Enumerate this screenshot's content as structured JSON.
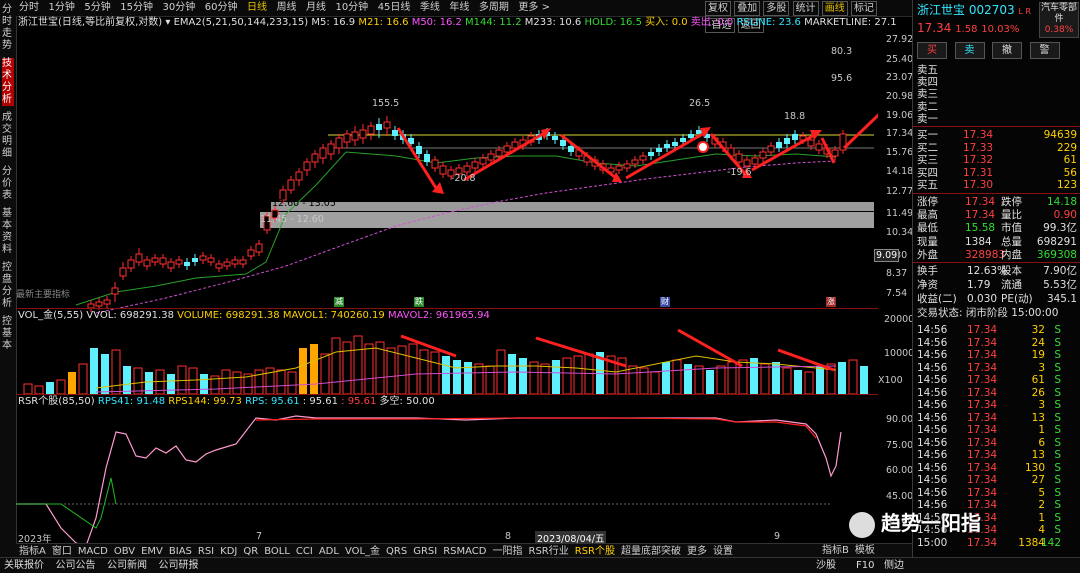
{
  "left_sidebar": [
    "分时走势",
    "技术分析",
    "成交明细",
    "分价表",
    "基本资料",
    "控盘分析",
    "控基本"
  ],
  "periods": [
    "分时",
    "1分钟",
    "5分钟",
    "15分钟",
    "30分钟",
    "60分钟",
    "日线",
    "周线",
    "月线",
    "10分钟",
    "45日线",
    "季线",
    "年线",
    "多周期",
    "更多 >"
  ],
  "active_period": "日线",
  "right_tools": [
    "复权",
    "叠加",
    "多股",
    "统计",
    "画线",
    "标记",
    "-自选",
    "返回"
  ],
  "ma_line": {
    "title": "浙江世宝(日线,等比前复权,对数)",
    "ema": "EMA2(5,21,50,144,233,15)",
    "m5": "M5: 16.9",
    "m21": "M21: 16.6",
    "m50": "M50: 16.2",
    "m144": "M144: 11.2",
    "m233": "M233: 10.6",
    "hold": "HOLD: 16.5",
    "buy": "买入: 0.0",
    "sell": "卖出: 0.0",
    "rsline": "RSLINE: 23.6",
    "marketline": "MARKETLINE: 27.1"
  },
  "price_axis": [
    "27.92",
    "25.40",
    "23.07",
    "20.98",
    "19.06",
    "17.34",
    "15.76",
    "14.18",
    "12.77",
    "11.49",
    "10.34",
    "9.30",
    "8.37",
    "7.54"
  ],
  "price_marker": "9.09",
  "chart_labels": {
    "l80_3": "80.3",
    "l95_6": "95.6",
    "l155_5": "155.5",
    "l26_5": "26.5",
    "l18_8": "18.8",
    "lm20_8": "-20.8",
    "lm19_6": "-19.6",
    "band_upper": "12.60 - 13.05",
    "band_lower": "11.45 - 12.60",
    "bottom_left": "最新主要指标"
  },
  "event_tags": [
    "减",
    "跌",
    "财",
    "涨"
  ],
  "vol_line": {
    "title": "VOL_金(5,55)",
    "vvol": "VVOL: 698291.38",
    "volume": "VOLUME: 698291.38",
    "mavol1": "MAVOL1: 740260.19",
    "mavol2": "MAVOL2: 961965.94"
  },
  "vol_axis": [
    "20000",
    "10000",
    "X100"
  ],
  "rsr_line": {
    "title": "RSR个股(85,50)",
    "rps41": "RPS41: 91.48",
    "rps144": "RPS144: 99.73",
    "rps": "RPS: 95.61",
    "rps2": ": 95.61",
    "rps3": ": 95.61",
    "dk": "多空: 50.00"
  },
  "rsr_axis": [
    "90.00",
    "75.00",
    "60.00",
    "45.00",
    "30.00"
  ],
  "date_axis": {
    "start": "2023年",
    "m7": "7",
    "m8": "8",
    "cursor": "2023/08/04/五",
    "m9": "9"
  },
  "bottom_tabs": [
    "指标A",
    "窗口",
    "MACD",
    "OBV",
    "EMV",
    "BIAS",
    "RSI",
    "KDJ",
    "QR",
    "BOLL",
    "CCI",
    "ADL",
    "VOL_金",
    "QRS",
    "GRSI",
    "RSMACD",
    "一阳指",
    "RSR行业",
    "RSR个股",
    "超量底部突破",
    "更多",
    "设置"
  ],
  "active_tab": "RSR个股",
  "bottom_right": [
    "指标B",
    "模板"
  ],
  "status": [
    "关联报价",
    "公司公告",
    "公司新闻",
    "公司研报"
  ],
  "status_right": [
    "沙股",
    "F10",
    "侧边"
  ],
  "panel": {
    "name": "浙江世宝",
    "code": "002703",
    "lr": "L R",
    "industry": "汽车零部件",
    "industry_pct": "0.38%",
    "price": "17.34",
    "change": "1.58",
    "pct": "10.03%",
    "btn_buy": "买",
    "btn_sell": "卖",
    "btn_cancel": "撤",
    "btn_alert": "警",
    "sell_rows": [
      "卖五",
      "卖四",
      "卖三",
      "卖二",
      "卖一"
    ],
    "buy_rows": [
      {
        "label": "买一",
        "price": "17.34",
        "vol": "94639"
      },
      {
        "label": "买二",
        "price": "17.33",
        "vol": "229"
      },
      {
        "label": "买三",
        "price": "17.32",
        "vol": "61"
      },
      {
        "label": "买四",
        "price": "17.31",
        "vol": "56"
      },
      {
        "label": "买五",
        "price": "17.30",
        "vol": "123"
      }
    ],
    "stats": [
      {
        "k1": "涨停",
        "v1": "17.34",
        "c1": "red",
        "k2": "跌停",
        "v2": "14.18",
        "c2": "grn"
      },
      {
        "k1": "最高",
        "v1": "17.34",
        "c1": "red",
        "k2": "量比",
        "v2": "0.90",
        "c2": "red"
      },
      {
        "k1": "最低",
        "v1": "15.58",
        "c1": "grn",
        "k2": "市值",
        "v2": "99.3亿",
        "c2": "wht"
      },
      {
        "k1": "现量",
        "v1": "1384",
        "c1": "wht",
        "k2": "总量",
        "v2": "698291",
        "c2": "wht"
      },
      {
        "k1": "外盘",
        "v1": "328983",
        "c1": "red",
        "k2": "内盘",
        "v2": "369308",
        "c2": "grn"
      }
    ],
    "stats2": [
      {
        "k1": "换手",
        "v1": "12.63%",
        "k2": "股本",
        "v2": "7.90亿"
      },
      {
        "k1": "净资",
        "v1": "1.79",
        "k2": "流通",
        "v2": "5.53亿"
      },
      {
        "k1": "收益(二)",
        "v1": "0.030",
        "k2": "PE(动)",
        "v2": "345.1"
      }
    ],
    "trade_state": "交易状态: 闭市阶段 15:00:00",
    "ticks": [
      {
        "t": "14:56",
        "p": "17.34",
        "v": "32",
        "s": "S"
      },
      {
        "t": "14:56",
        "p": "17.34",
        "v": "24",
        "s": "S"
      },
      {
        "t": "14:56",
        "p": "17.34",
        "v": "19",
        "s": "S"
      },
      {
        "t": "14:56",
        "p": "17.34",
        "v": "3",
        "s": "S"
      },
      {
        "t": "14:56",
        "p": "17.34",
        "v": "61",
        "s": "S"
      },
      {
        "t": "14:56",
        "p": "17.34",
        "v": "26",
        "s": "S"
      },
      {
        "t": "14:56",
        "p": "17.34",
        "v": "3",
        "s": "S"
      },
      {
        "t": "14:56",
        "p": "17.34",
        "v": "13",
        "s": "S"
      },
      {
        "t": "14:56",
        "p": "17.34",
        "v": "1",
        "s": "S"
      },
      {
        "t": "14:56",
        "p": "17.34",
        "v": "6",
        "s": "S"
      },
      {
        "t": "14:56",
        "p": "17.34",
        "v": "13",
        "s": "S"
      },
      {
        "t": "14:56",
        "p": "17.34",
        "v": "130",
        "s": "S"
      },
      {
        "t": "14:56",
        "p": "17.34",
        "v": "27",
        "s": "S"
      },
      {
        "t": "14:56",
        "p": "17.34",
        "v": "5",
        "s": "S"
      },
      {
        "t": "14:56",
        "p": "17.34",
        "v": "2",
        "s": "S"
      },
      {
        "t": "14:56",
        "p": "17.34",
        "v": "1",
        "s": "S"
      },
      {
        "t": "14:56",
        "p": "17.34",
        "v": "4",
        "s": "S"
      },
      {
        "t": "15:00",
        "p": "17.34",
        "v": "1384",
        "s": "142"
      }
    ],
    "watermark": "趋势一阳指"
  }
}
